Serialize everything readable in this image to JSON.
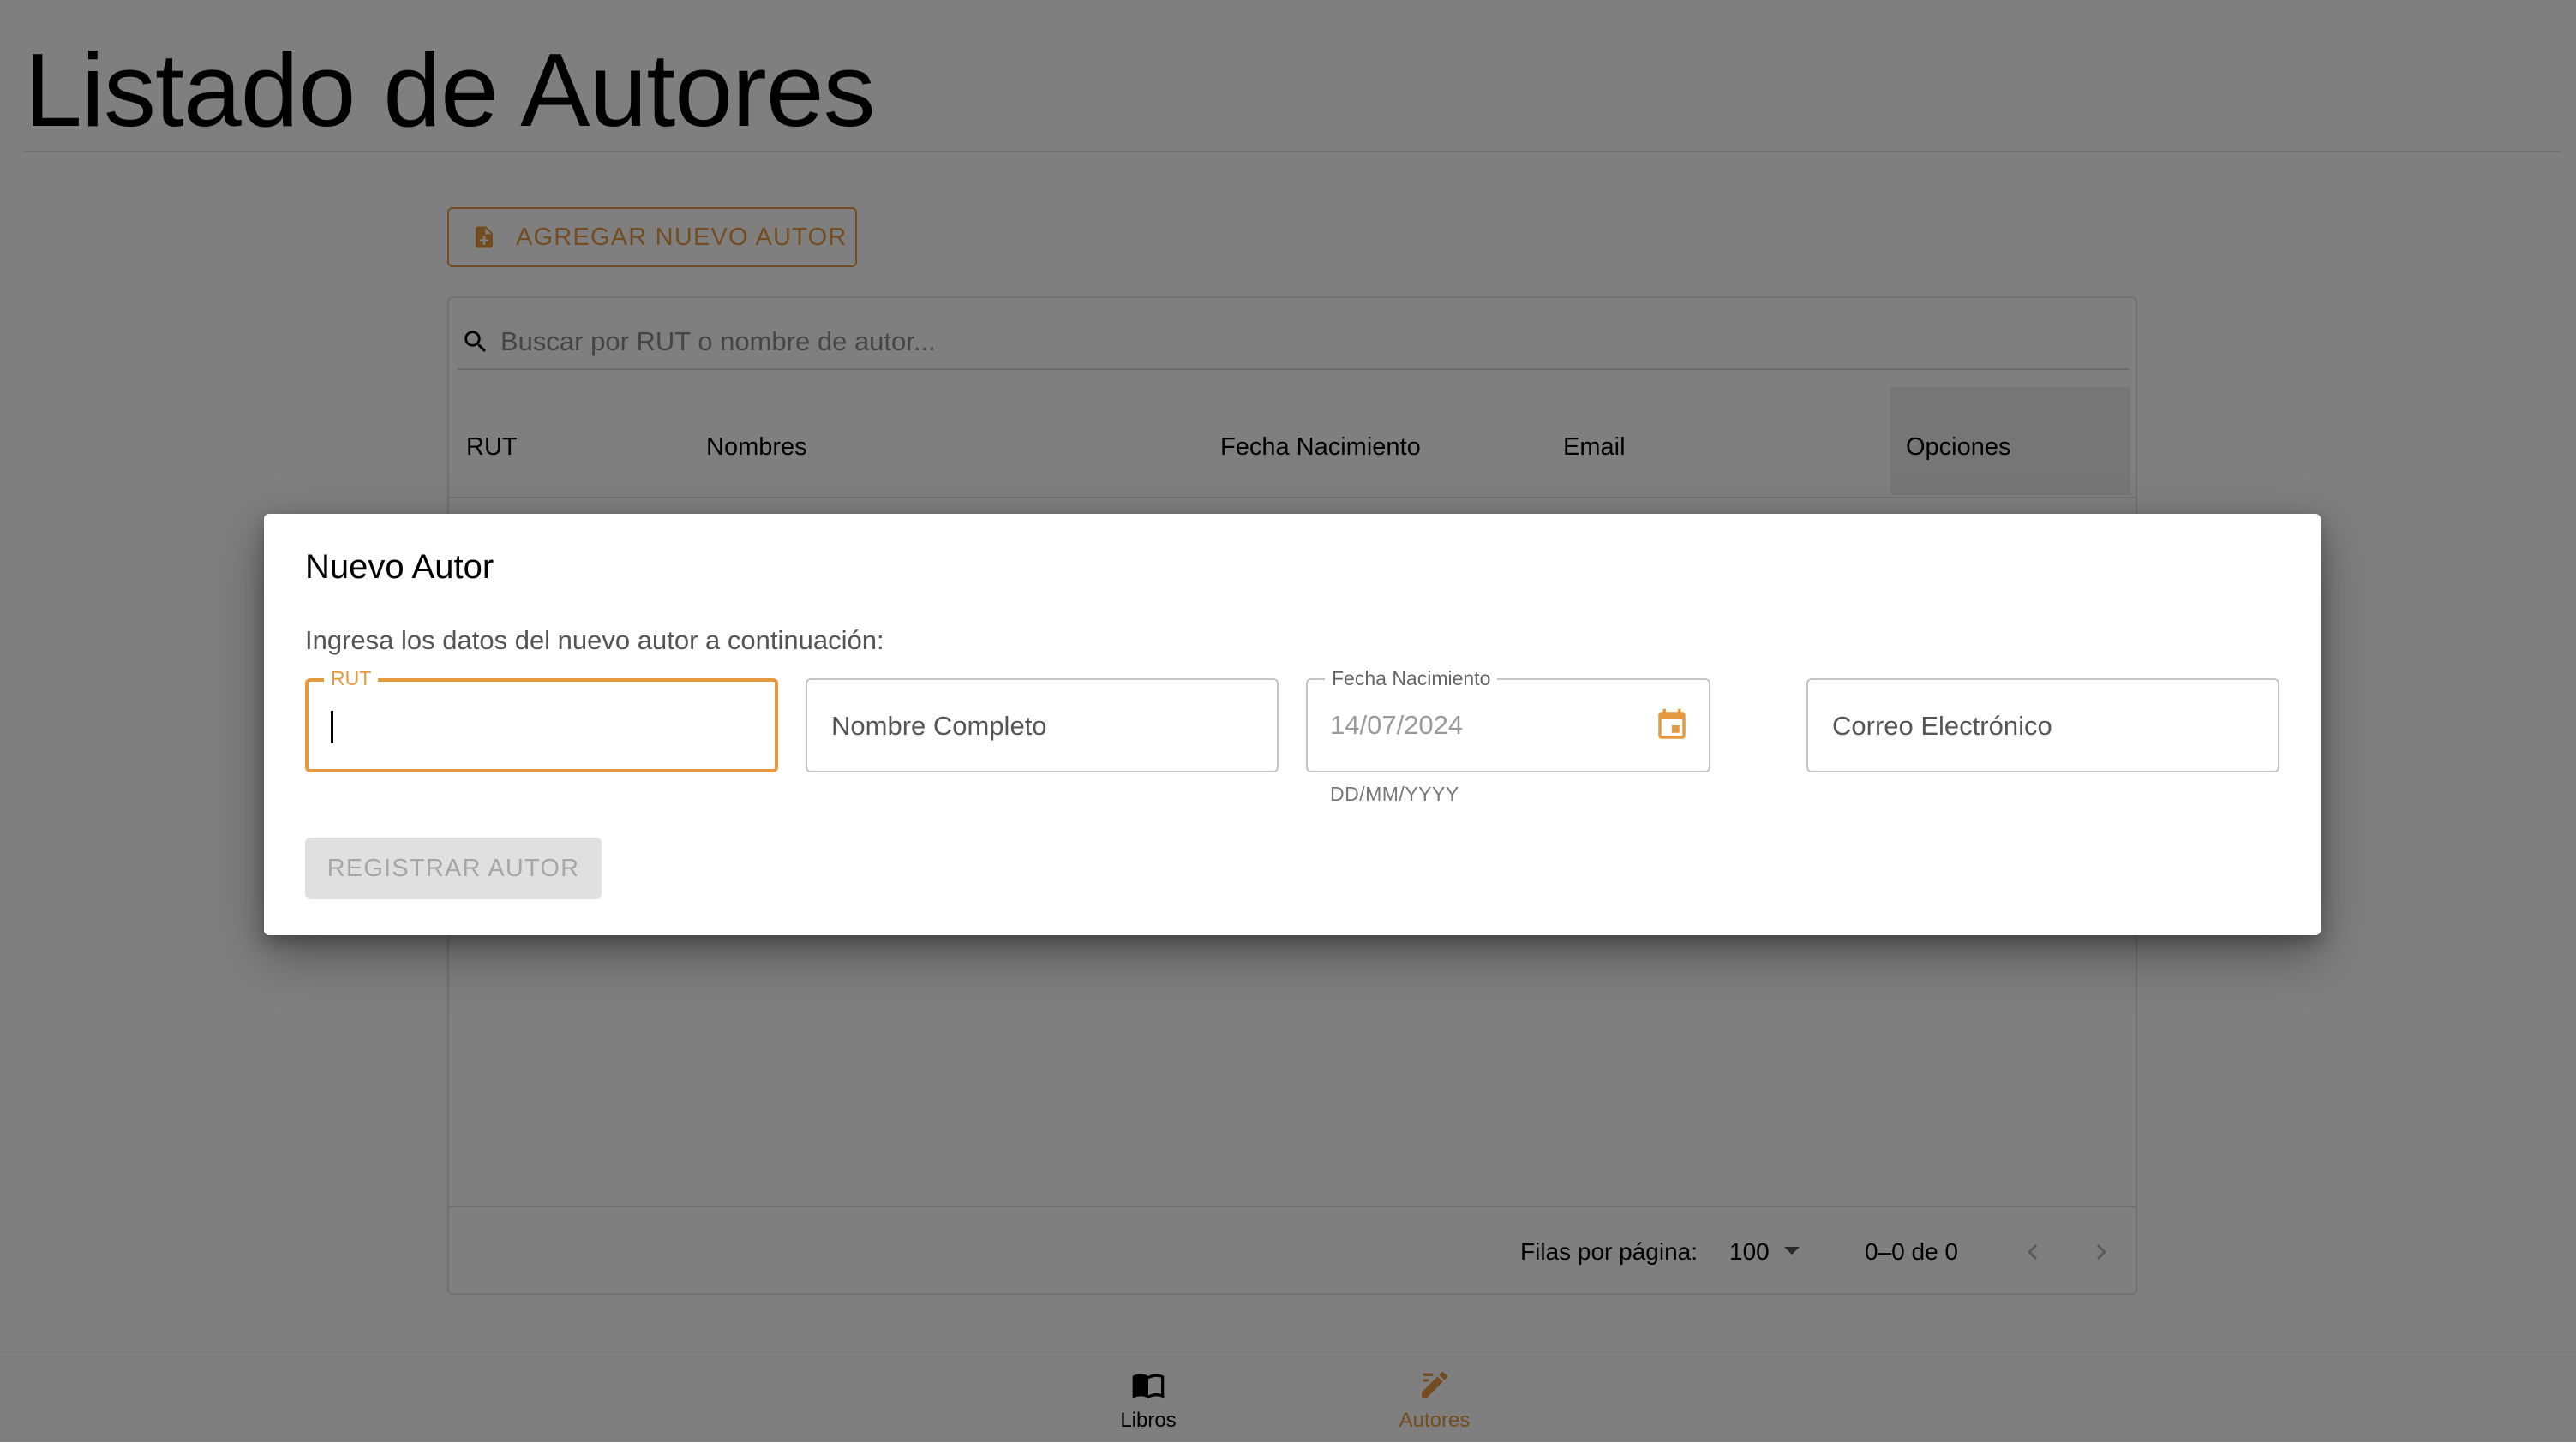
{
  "page": {
    "title": "Listado de Autores"
  },
  "toolbar": {
    "add_label": "AGREGAR NUEVO AUTOR"
  },
  "search": {
    "placeholder": "Buscar por RUT o nombre de autor..."
  },
  "table": {
    "columns": [
      "RUT",
      "Nombres",
      "Fecha Nacimiento",
      "Email",
      "Opciones"
    ],
    "rows": []
  },
  "pagination": {
    "rows_per_page_label": "Filas por página:",
    "rows_per_page": "100",
    "range": "0–0 de 0"
  },
  "bottom_nav": {
    "items": [
      {
        "label": "Libros",
        "icon": "book-icon",
        "active": false
      },
      {
        "label": "Autores",
        "icon": "edit-icon",
        "active": true
      }
    ]
  },
  "dialog": {
    "title": "Nuevo Autor",
    "description": "Ingresa los datos del nuevo autor a continuación:",
    "fields": {
      "rut": {
        "label": "RUT",
        "value": ""
      },
      "nombre": {
        "placeholder": "Nombre Completo"
      },
      "fecha": {
        "label": "Fecha Nacimiento",
        "value": "14/07/2024",
        "helper": "DD/MM/YYYY"
      },
      "correo": {
        "placeholder": "Correo Electrónico"
      }
    },
    "submit_label": "REGISTRAR AUTOR"
  },
  "colors": {
    "accent": "#e69a3f",
    "overlay": "rgba(0,0,0,0.5)",
    "disabled_bg": "#e0e0e0",
    "disabled_text": "#a6a6a6"
  }
}
